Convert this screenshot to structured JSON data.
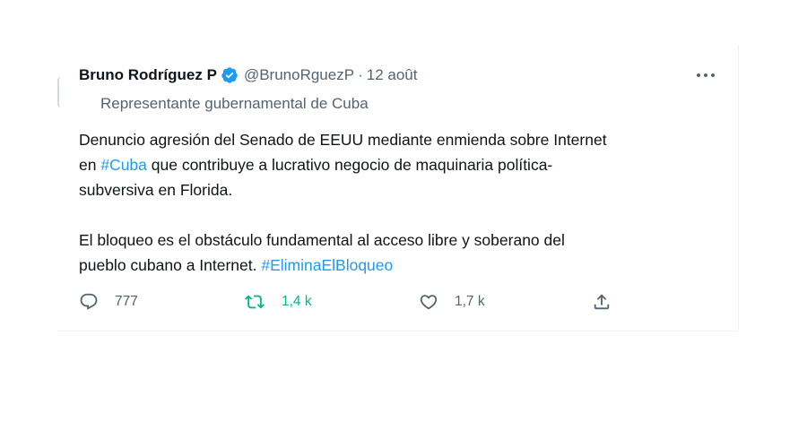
{
  "tweet": {
    "author_name": "Bruno Rodríguez P",
    "handle": "@BrunoRguezP",
    "separator": "·",
    "date": "12 août",
    "label": "Representante gubernamental de Cuba",
    "text": {
      "p1_line1": "Denuncio agresión del Senado de EEUU mediante enmienda sobre Internet",
      "p1_line2_pre": "en ",
      "hashtag_cuba": "#Cuba",
      "p1_line2_post": " que contribuye a lucrativo negocio de maquinaria política-",
      "p1_line3": "subversiva en Florida.",
      "p2_line1": "El bloqueo es el obstáculo fundamental al acceso libre y soberano del",
      "p2_line2_pre": "pueblo cubano a Internet. ",
      "hashtag_bloqueo": "#EliminaElBloqueo"
    },
    "actions": {
      "reply_count": "777",
      "retweet_count": "1,4 k",
      "like_count": "1,7 k"
    },
    "colors": {
      "accent": "#1d9bf0",
      "retweet_active": "#00ba7c",
      "secondary_text": "#536471"
    }
  }
}
